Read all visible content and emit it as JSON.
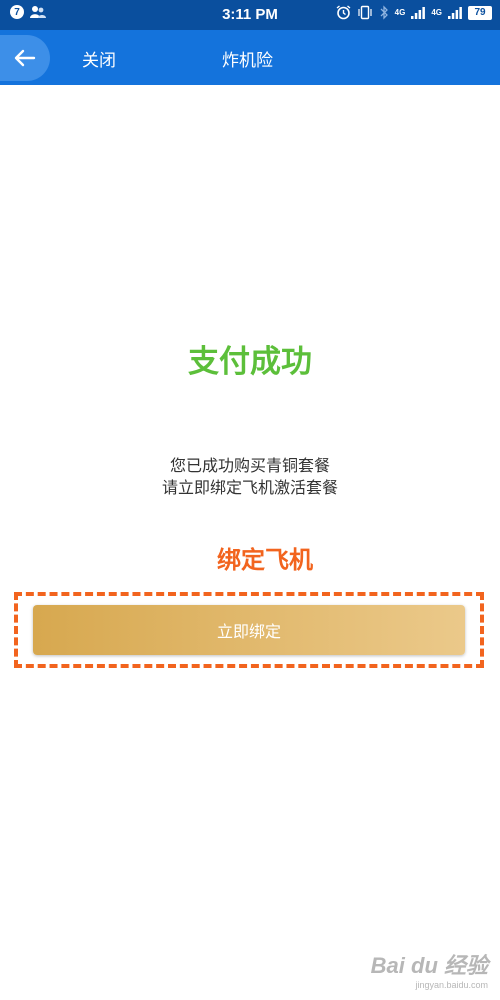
{
  "status_bar": {
    "notification_count": "7",
    "time": "3:11 PM",
    "network_1": "4G",
    "network_2": "4G",
    "battery": "79",
    "icons": [
      "notification-badge-icon",
      "contacts-icon",
      "alarm-icon",
      "vibrate-icon",
      "bluetooth-icon",
      "signal-icon",
      "battery-icon"
    ]
  },
  "header": {
    "back_icon": "arrow-left-icon",
    "close_label": "关闭",
    "title": "炸机险"
  },
  "main": {
    "success_title": "支付成功",
    "message_line1": "您已成功购买青铜套餐",
    "message_line2": "请立即绑定飞机激活套餐",
    "bind_heading": "绑定飞机",
    "bind_button_label": "立即绑定"
  },
  "watermark": {
    "logo": "Bai du 经验",
    "url": "jingyan.baidu.com"
  },
  "colors": {
    "status_bar": "#0a4f9e",
    "header": "#1473dc",
    "success": "#5cbf3a",
    "accent_orange": "#f2641e",
    "button_gold_start": "#d7a84f",
    "button_gold_end": "#ebc98a"
  }
}
